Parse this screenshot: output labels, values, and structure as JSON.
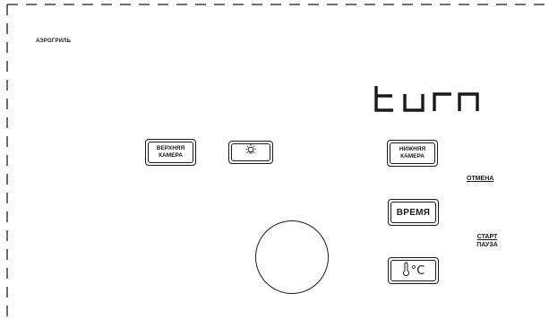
{
  "panel": {
    "brand": "АЭРОГРИЛЬ"
  },
  "display": {
    "text": "turn"
  },
  "buttons": {
    "upper_chamber": "ВЕРХНЯЯ\nКАМЕРА",
    "lower_chamber": "НИЖНЯЯ\nКАМЕРА",
    "time": "ВРЕМЯ",
    "temp_unit": "°C"
  },
  "links": {
    "cancel": "ОТМЕНА",
    "start": "СТАРТ",
    "pause": "ПАУЗА"
  },
  "icons": {
    "light": "light-bulb-icon",
    "thermometer": "thermometer-icon"
  },
  "colors": {
    "line": "#1a1a1a",
    "background": "#ffffff"
  }
}
